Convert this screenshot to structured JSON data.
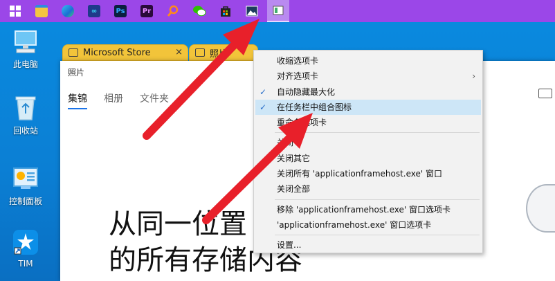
{
  "taskbar": {
    "icons": [
      "windows-start-icon",
      "file-explorer-icon",
      "edge-browser-icon",
      "app-icon",
      "photoshop-icon",
      "premiere-icon",
      "search-app-icon",
      "wechat-icon",
      "store-bag-icon",
      "photos-icon",
      "app-window-icon"
    ],
    "ps_text": "Ps",
    "pr_text": "Pr"
  },
  "desktop": {
    "this_pc": "此电脑",
    "recycle_bin": "回收站",
    "control_panel": "控制面板",
    "tim": "TIM"
  },
  "tabs": {
    "store_label": "Microsoft Store",
    "photos_label": "照片",
    "close_glyph": "×"
  },
  "app": {
    "title": "照片",
    "nav": [
      "集锦",
      "相册",
      "文件夹"
    ],
    "big_text_line1": "从同一位置",
    "big_text_line2": "的所有存储内容"
  },
  "menu": {
    "item_collapse": "收缩选项卡",
    "item_align": "对齐选项卡",
    "item_autohide": "自动隐藏最大化",
    "item_group": "在任务栏中组合图标",
    "item_rename": "重命名选项卡",
    "item_close": "关闭",
    "item_close_others": "关闭其它",
    "item_close_all_app": "关闭所有 'applicationframehost.exe' 窗口",
    "item_close_all": "关闭全部",
    "item_remove": "移除 'applicationframehost.exe' 窗口选项卡",
    "item_appframe_tab": "'applicationframehost.exe' 窗口选项卡",
    "item_settings": "设置...",
    "check_glyph": "✓",
    "arrow_glyph": "›"
  },
  "colors": {
    "taskbar": "#9b47e8",
    "desktop": "#0a7fd6",
    "tab": "#f2c43a",
    "arrow": "#e8202a",
    "highlight": "#cde6f7"
  }
}
